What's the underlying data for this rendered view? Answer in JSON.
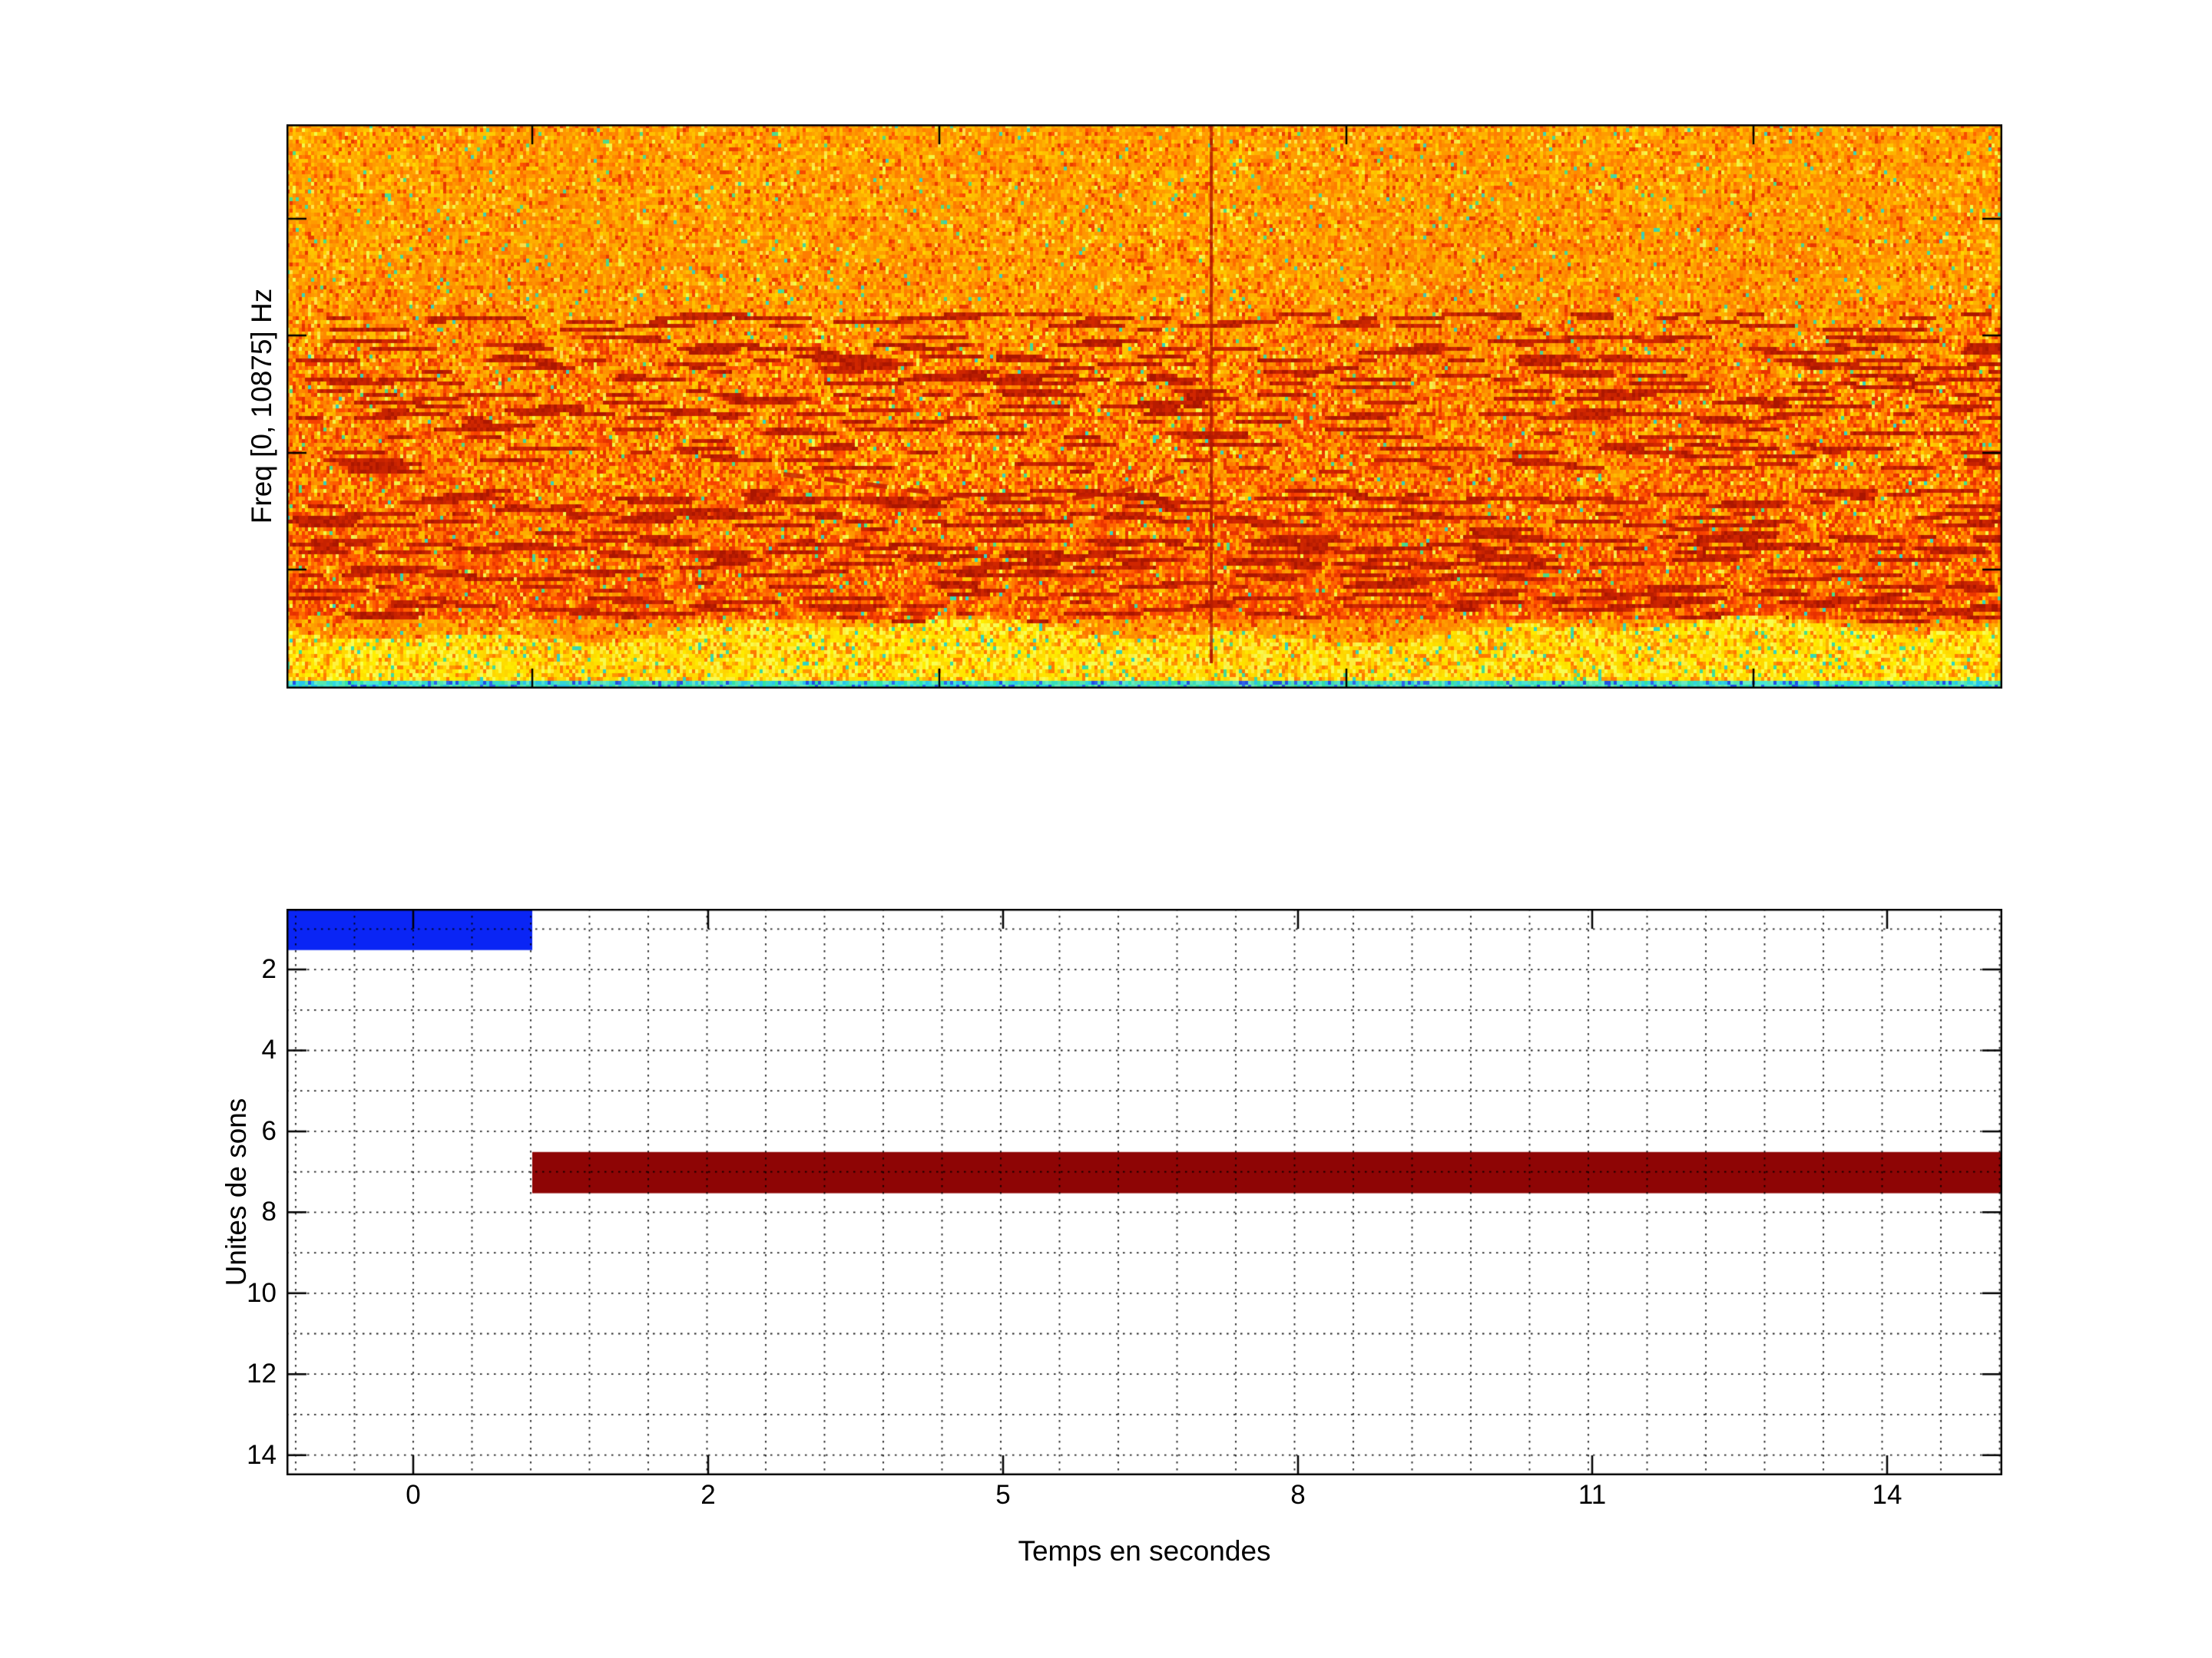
{
  "figure": {
    "background": "#ffffff",
    "description": "MATLAB-style figure: speech spectrogram on top, sound-unit piano-roll timeline below"
  },
  "chart_data": [
    {
      "type": "heatmap",
      "subtype": "spectrogram",
      "title": "",
      "xlabel": "",
      "ylabel": "Freq [0, 10875] Hz",
      "x_tick_labels": [],
      "y_tick_labels": [],
      "freq_range_hz": [
        0,
        10875
      ],
      "colormap": "jet",
      "legend": "none",
      "grid": "off",
      "content": {
        "base_noise": "orange/yellow speckle (mid energy) over full panel",
        "zones": [
          {
            "name": "upper-noise",
            "rel_y": [
              0.0,
              0.4
            ],
            "palette": "orange with yellow and rare teal specks"
          },
          {
            "name": "formant-region",
            "rel_y": [
              0.4,
              0.875
            ],
            "palette": "red-orange with dark-red horizontal streaks"
          },
          {
            "name": "low-freq-band",
            "rel_y": [
              0.875,
              0.982
            ],
            "palette": "bright yellow with orange specks"
          },
          {
            "name": "near-dc-strip",
            "rel_y": [
              0.982,
              1.0
            ],
            "palette": "cyan/green with blue specks"
          }
        ],
        "event_line": {
          "kind": "vertical broadband click",
          "rel_x": 0.539,
          "rel_y_span": [
            0.0,
            0.947
          ],
          "color": "#b21a00"
        },
        "wavy_formant": {
          "rel_x_span": [
            0.29,
            0.53
          ],
          "rel_y_center": 0.64,
          "color": "#c81e00"
        }
      },
      "band_rows_rel_y": [
        0.345,
        0.389,
        0.419,
        0.449,
        0.48,
        0.512,
        0.544,
        0.571,
        0.599,
        0.661,
        0.694,
        0.732,
        0.752,
        0.77,
        0.793,
        0.816,
        0.838,
        0.857
      ],
      "palettes": {
        "oranges": [
          "#ff9800",
          "#ff8a00",
          "#ffa200",
          "#ff7c00",
          "#ffb300",
          "#ffc400"
        ],
        "reds": [
          "#ff5f00",
          "#ff4d00",
          "#f74300",
          "#ea3500",
          "#ff6a00",
          "#e63000"
        ],
        "dark_reds": [
          "#c62200",
          "#b81c00",
          "#d02600",
          "#aa1500"
        ],
        "yellow_specks": [
          "#ffd900",
          "#ffe64d",
          "#f2ff4d",
          "#ffcf00"
        ],
        "teals": [
          "#3bdca4",
          "#2fd6c3",
          "#45e08c"
        ],
        "yellow_band": [
          "#ffe600",
          "#fff23d",
          "#ffef00",
          "#ffe000",
          "#f8ff52",
          "#ffd900"
        ],
        "yellow_band_orange": [
          "#ffb300",
          "#ff9800",
          "#ff7a00"
        ],
        "cyan_strip": [
          "#27c8ec",
          "#2fd9de",
          "#38dfc0",
          "#2ee6a8",
          "#49e8d4",
          "#55e8b0",
          "#68efc4"
        ],
        "cyan_strip_blue": [
          "#1f4fe8",
          "#2a66f0"
        ]
      }
    },
    {
      "type": "bar",
      "subtype": "piano-roll-gantt",
      "title": "",
      "xlabel": "Temps en secondes",
      "ylabel": "Unites de sons",
      "x_tick_labels": [
        "0",
        "2",
        "5",
        "8",
        "11",
        "14"
      ],
      "y_tick_labels": [
        "2",
        "4",
        "6",
        "8",
        "10",
        "12",
        "14"
      ],
      "ylim": [
        0.5,
        14.5
      ],
      "y_axis_direction": "reversed",
      "xlim_seconds_approx": [
        -0.9,
        15.2
      ],
      "grid": {
        "style": "dotted",
        "x_minor_per_major": 5,
        "y_lines_every_unit": 1
      },
      "bars": [
        {
          "unit": 1,
          "start_s": -0.9,
          "end_s": 0.8,
          "color": "#0a25f5",
          "note": "starts at left plot edge"
        },
        {
          "unit": 7,
          "start_s": 0.8,
          "end_s": 15.2,
          "color": "#8e0505",
          "note": "extends to right plot edge"
        }
      ]
    }
  ]
}
